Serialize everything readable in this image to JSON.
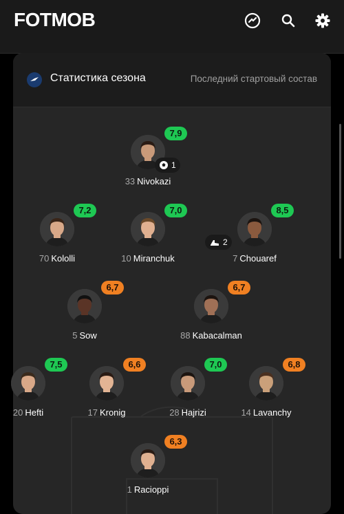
{
  "app": {
    "logo": "FOTMOB"
  },
  "card": {
    "title": "Статистика сезона",
    "subtitle": "Последний стартовый состав"
  },
  "colors": {
    "good": "#1ec853",
    "average": "#f08022",
    "background": "#262626"
  },
  "players": [
    {
      "number": "33",
      "name": "Nivokazi",
      "rating": "7,9",
      "rating_level": "green",
      "event": {
        "icon": "football-icon",
        "count": "1"
      }
    },
    {
      "number": "70",
      "name": "Kololli",
      "rating": "7,2",
      "rating_level": "green"
    },
    {
      "number": "10",
      "name": "Miranchuk",
      "rating": "7,0",
      "rating_level": "green"
    },
    {
      "number": "7",
      "name": "Chouaref",
      "rating": "8,5",
      "rating_level": "green",
      "event": {
        "icon": "boot-icon",
        "count": "2"
      }
    },
    {
      "number": "5",
      "name": "Sow",
      "rating": "6,7",
      "rating_level": "orange"
    },
    {
      "number": "88",
      "name": "Kabacalman",
      "rating": "6,7",
      "rating_level": "orange"
    },
    {
      "number": "20",
      "name": "Hefti",
      "rating": "7,5",
      "rating_level": "green"
    },
    {
      "number": "17",
      "name": "Kronig",
      "rating": "6,6",
      "rating_level": "orange"
    },
    {
      "number": "28",
      "name": "Hajrizi",
      "rating": "7,0",
      "rating_level": "green"
    },
    {
      "number": "14",
      "name": "Lavanchy",
      "rating": "6,8",
      "rating_level": "orange"
    },
    {
      "number": "1",
      "name": "Racioppi",
      "rating": "6,3",
      "rating_level": "orange"
    }
  ]
}
